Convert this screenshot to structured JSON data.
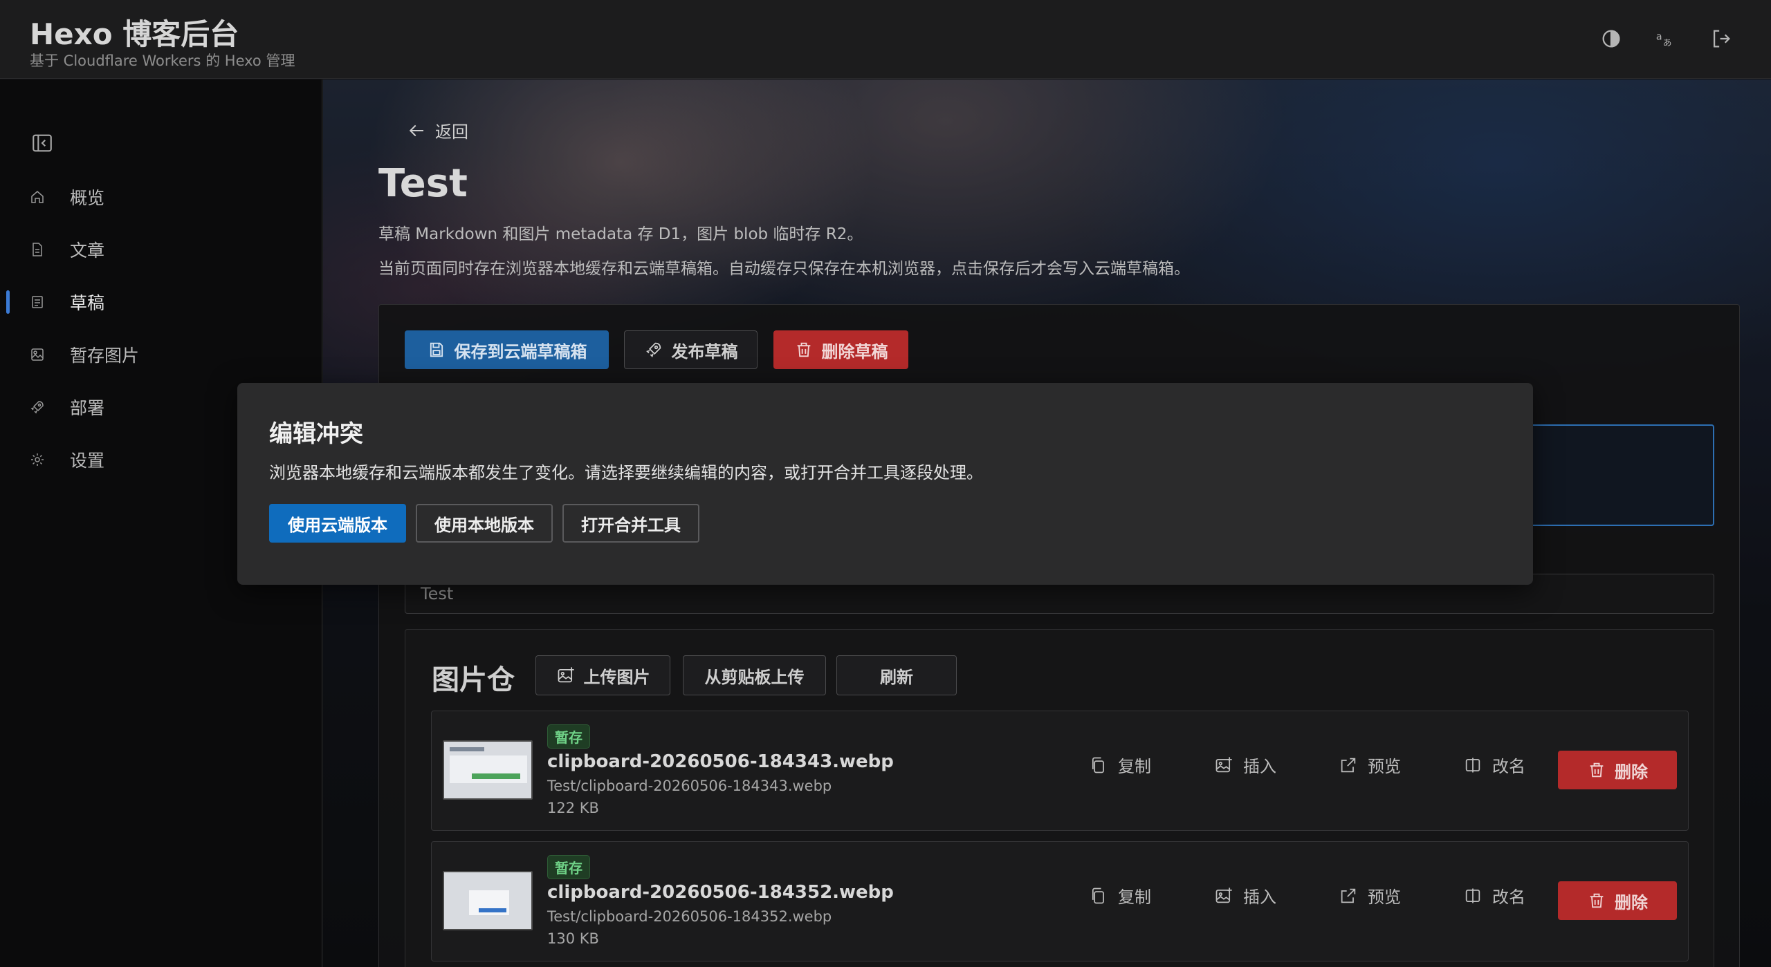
{
  "app": {
    "title": "Hexo 博客后台",
    "subtitle": "基于 Cloudflare Workers 的 Hexo 管理"
  },
  "topbar_icons": [
    "contrast-icon",
    "language-icon",
    "logout-icon"
  ],
  "sidebar": {
    "items": [
      {
        "label": "概览",
        "icon": "home-icon",
        "active": false
      },
      {
        "label": "文章",
        "icon": "document-icon",
        "active": false
      },
      {
        "label": "草稿",
        "icon": "draft-icon",
        "active": true
      },
      {
        "label": "暂存图片",
        "icon": "image-icon",
        "active": false
      },
      {
        "label": "部署",
        "icon": "rocket-icon",
        "active": false
      },
      {
        "label": "设置",
        "icon": "gear-icon",
        "active": false
      }
    ]
  },
  "page": {
    "back_label": "返回",
    "title": "Test",
    "desc1": "草稿 Markdown 和图片 metadata 存 D1，图片 blob 临时存 R2。",
    "desc2": "当前页面同时存在浏览器本地缓存和云端草稿箱。自动缓存只保存在本机浏览器，点击保存后才会写入云端草稿箱。"
  },
  "toolbar": {
    "save_label": "保存到云端草稿箱",
    "publish_label": "发布草稿",
    "delete_label": "删除草稿"
  },
  "title_input": {
    "value": "Test"
  },
  "image_repo": {
    "title": "图片仓",
    "upload_label": "上传图片",
    "clipboard_label": "从剪贴板上传",
    "refresh_label": "刷新",
    "items": [
      {
        "badge": "暂存",
        "name": "clipboard-20260506-184343.webp",
        "path": "Test/clipboard-20260506-184343.webp",
        "size": "122 KB"
      },
      {
        "badge": "暂存",
        "name": "clipboard-20260506-184352.webp",
        "path": "Test/clipboard-20260506-184352.webp",
        "size": "130 KB"
      }
    ],
    "actions": {
      "copy": "复制",
      "insert": "插入",
      "preview": "预览",
      "rename": "改名",
      "delete": "删除"
    }
  },
  "dialog": {
    "title": "编辑冲突",
    "message": "浏览器本地缓存和云端版本都发生了变化。请选择要继续编辑的内容，或打开合并工具逐段处理。",
    "use_cloud_label": "使用云端版本",
    "use_local_label": "使用本地版本",
    "open_merge_label": "打开合并工具"
  },
  "colors": {
    "accent": "#0f6cbd",
    "danger": "#b42a2a",
    "badge_green": "#6fd287"
  }
}
